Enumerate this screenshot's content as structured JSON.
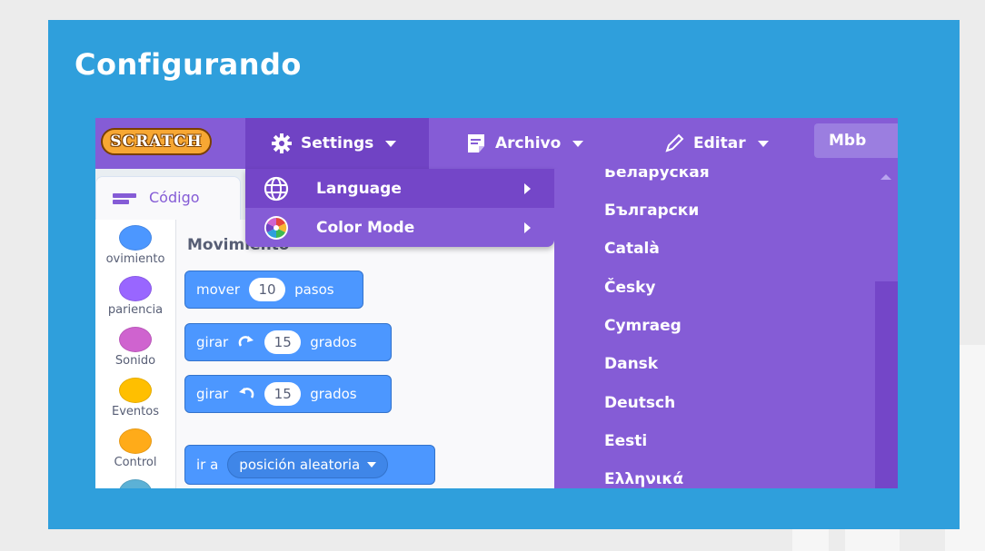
{
  "slide": {
    "title": "Configurando"
  },
  "menubar": {
    "logo": "SCRATCH",
    "settings_label": "Settings",
    "file_label": "Archivo",
    "edit_label": "Editar",
    "user_label": "Mbb"
  },
  "settings_menu": {
    "items": [
      {
        "label": "Language",
        "icon": "globe-icon"
      },
      {
        "label": "Color Mode",
        "icon": "color-wheel-icon"
      }
    ]
  },
  "language_menu": {
    "items": [
      "Беларуская",
      "Български",
      "Català",
      "Česky",
      "Cymraeg",
      "Dansk",
      "Deutsch",
      "Eesti",
      "Ελληνικά"
    ]
  },
  "editor": {
    "tab_code": "Código",
    "categories": [
      {
        "label": "ovimiento",
        "color": "#4c97ff"
      },
      {
        "label": "pariencia",
        "color": "#9966ff"
      },
      {
        "label": "Sonido",
        "color": "#cf63cf"
      },
      {
        "label": "Eventos",
        "color": "#ffbf00"
      },
      {
        "label": "Control",
        "color": "#ffab19"
      }
    ],
    "palette_heading": "Movimiento",
    "blocks": {
      "move": {
        "label": "mover",
        "value": "10",
        "unit": "pasos"
      },
      "turn_right": {
        "label": "girar",
        "value": "15",
        "unit": "grados"
      },
      "turn_left": {
        "label": "girar",
        "value": "15",
        "unit": "grados"
      },
      "goto": {
        "label": "ir a",
        "dropdown": "posición aleatoria"
      }
    }
  },
  "colors": {
    "slide_bg": "#2f9fdc",
    "menu_purple": "#855cd6",
    "motion_blue": "#4c97ff"
  }
}
